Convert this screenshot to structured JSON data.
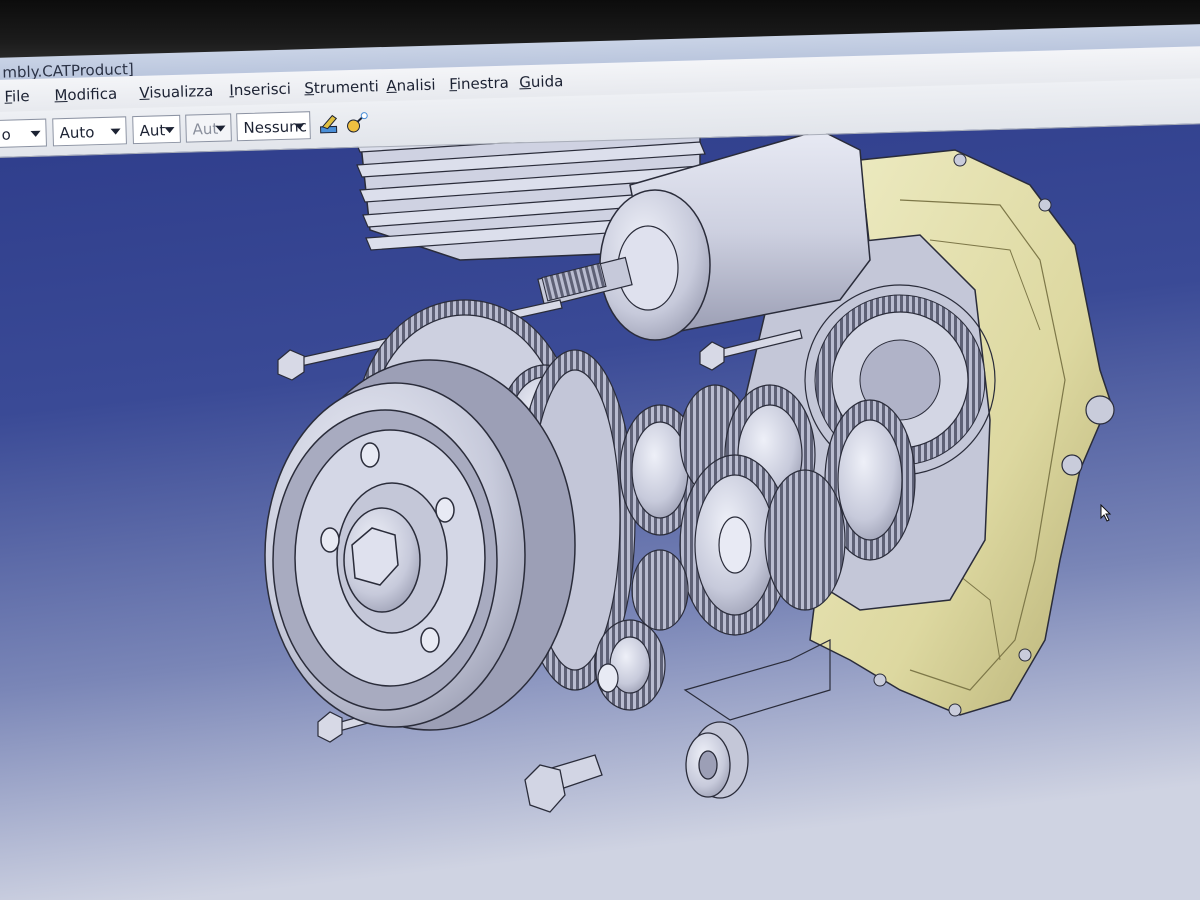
{
  "window": {
    "title": "mbly.CATProduct]"
  },
  "menu": [
    "File",
    "Modifica",
    "Visualizza",
    "Inserisci",
    "Strumenti",
    "Analisi",
    "Finestra",
    "Guida"
  ],
  "toolbar": {
    "combos": [
      {
        "value": "o",
        "disabled": false
      },
      {
        "value": "Auto",
        "disabled": false
      },
      {
        "value": "Aut",
        "disabled": false
      },
      {
        "value": "Aut",
        "disabled": true
      },
      {
        "value": "Nessunc",
        "disabled": false
      }
    ],
    "icons": [
      "paint-brush-icon",
      "sparkle-wand-icon"
    ]
  },
  "model": {
    "part_colors": {
      "metal": "#c9ccdb",
      "metal_dark": "#8d90a5",
      "case": "#e6e3b4",
      "case_dark": "#b8b27a",
      "outline": "#2a2c3a"
    },
    "background": {
      "top": "#2a3a86",
      "bottom": "#c9cfe0"
    }
  }
}
